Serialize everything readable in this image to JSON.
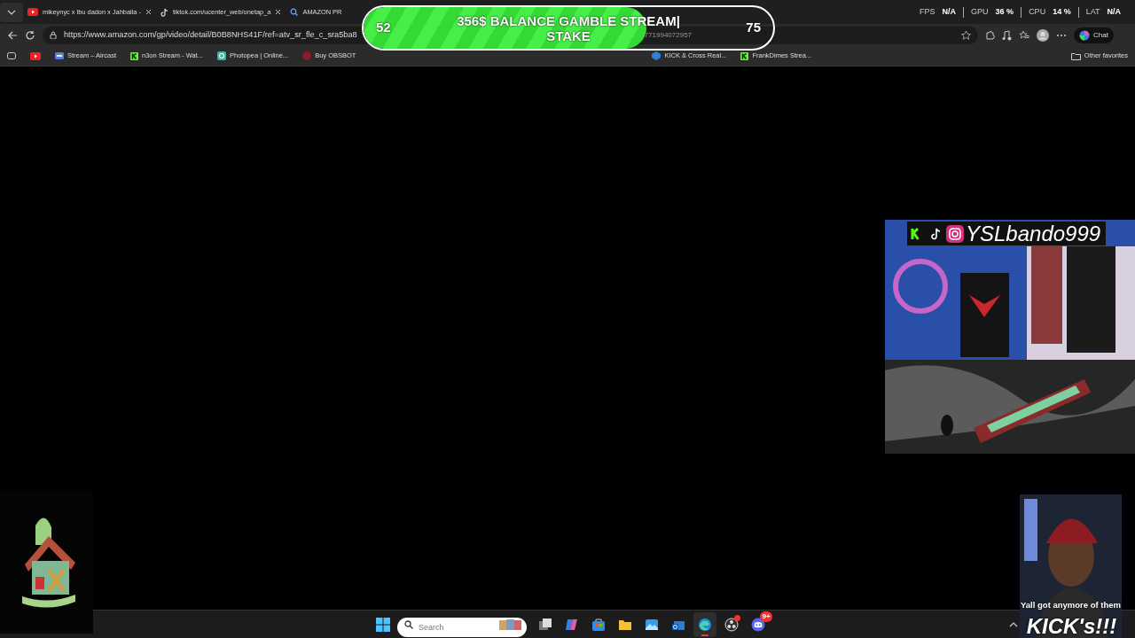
{
  "tabs": [
    {
      "kind": "play",
      "title": "mikeynyc x lbu dadon x Jahballa -"
    },
    {
      "kind": "note",
      "title": "tiktok.com/ucenter_web/onetap_a"
    },
    {
      "kind": "search",
      "title": "AMAZON PR"
    }
  ],
  "stats": [
    {
      "label": "FPS",
      "value": "N/A"
    },
    {
      "label": "GPU",
      "value": "36 %"
    },
    {
      "label": "CPU",
      "value": "14 %"
    },
    {
      "label": "LAT",
      "value": "N/A"
    }
  ],
  "address": {
    "url": "https://www.amazon.com/gp/video/detail/B0B8NHS41F/ref=atv_sr_fle_c_sra5ba8",
    "url_tail": "771994072957"
  },
  "chat_button": "Chat",
  "bookmarks": [
    {
      "kind": "play"
    },
    {
      "kind": "stream",
      "label": "Stream – Aircast"
    },
    {
      "kind": "k",
      "label": "n3on Stream - Wat..."
    },
    {
      "kind": "ring",
      "label": "Photopea | Online..."
    },
    {
      "kind": "dot",
      "label": "Buy OBSBOT"
    },
    {
      "kind": "cube",
      "label": "KICK & Cross Real..."
    },
    {
      "kind": "k",
      "label": "FrankDimes Strea..."
    }
  ],
  "other_favorites": "Other favorites",
  "goal_bar": {
    "start": "52",
    "end": "75",
    "title": "356$ BALANCE GAMBLE STREAM|",
    "subtitle": "STAKE",
    "level": 0.69
  },
  "webcam": {
    "kind": "picture",
    "handle": "YSLbando999"
  },
  "meme": {
    "kind": "picture",
    "caption_top": "Yall got anymore of them",
    "caption_bottom": "KICK's!!!"
  },
  "taskbar": {
    "search_placeholder": "Search",
    "apps": [
      {
        "kind": "taskview",
        "active": false
      },
      {
        "kind": "copilot",
        "active": false
      },
      {
        "kind": "store",
        "active": false
      },
      {
        "kind": "folder",
        "active": false
      },
      {
        "kind": "photos",
        "active": false
      },
      {
        "kind": "mail",
        "active": false
      },
      {
        "kind": "edge",
        "active": true
      },
      {
        "kind": "obs",
        "active": false,
        "alert": true
      },
      {
        "kind": "discord",
        "active": false,
        "badge": "9+"
      }
    ]
  }
}
